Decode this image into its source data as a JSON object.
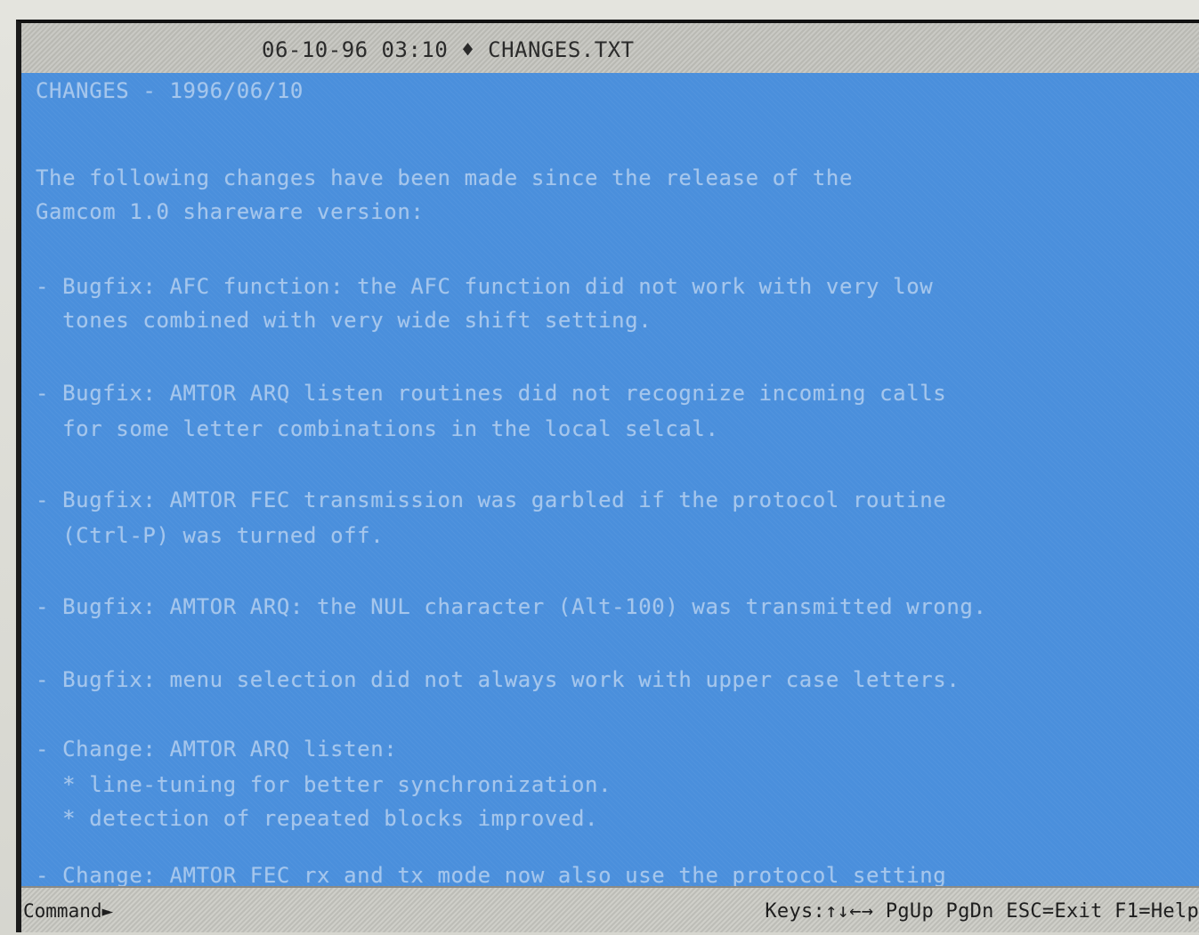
{
  "window": {
    "title": "06-10-96 03:10 ♦ CHANGES.TXT"
  },
  "document": {
    "lines": [
      "CHANGES - 1996/06/10",
      "The following changes have been made since the release of the",
      "Gamcom 1.0 shareware version:",
      "- Bugfix: AFC function: the AFC function did not work with very low",
      "  tones combined with very wide shift setting.",
      "- Bugfix: AMTOR ARQ listen routines did not recognize incoming calls",
      "  for some letter combinations in the local selcal.",
      "- Bugfix: AMTOR FEC transmission was garbled if the protocol routine",
      "  (Ctrl-P) was turned off.",
      "- Bugfix: AMTOR ARQ: the NUL character (Alt-100) was transmitted wrong.",
      "- Bugfix: menu selection did not always work with upper case letters.",
      "- Change: AMTOR ARQ listen:",
      "  * line-tuning for better synchronization.",
      "  * detection of repeated blocks improved.",
      "- Change: AMTOR FEC rx and tx mode now also use the protocol setting"
    ]
  },
  "statusbar": {
    "command_label": "Command►",
    "command_value": "",
    "keys_hint": "Keys:↑↓←→ PgUp PgDn ESC=Exit F1=Help"
  }
}
